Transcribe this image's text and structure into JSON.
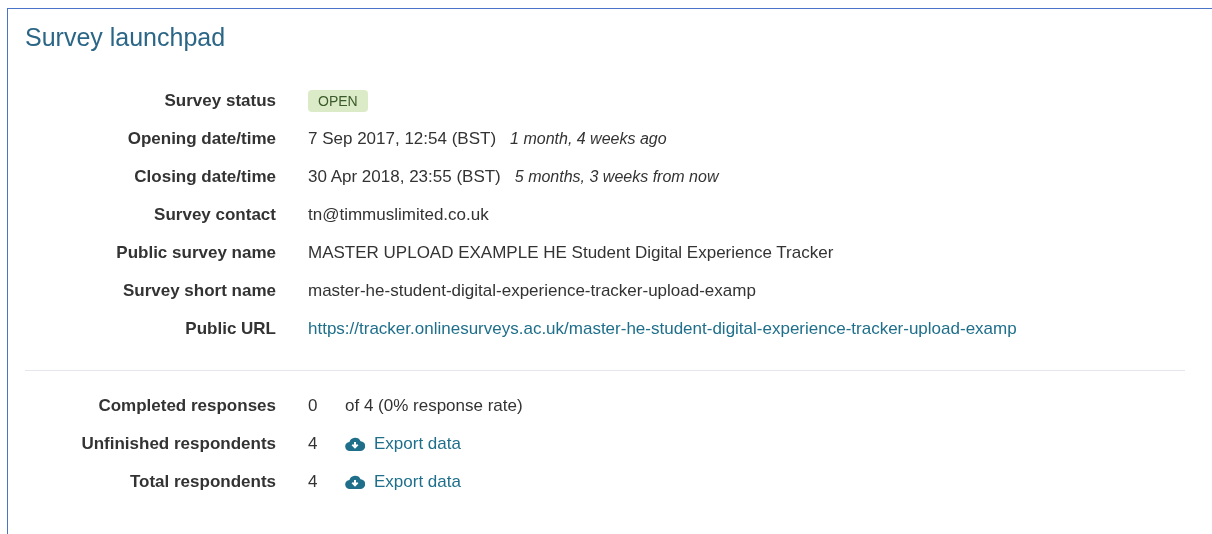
{
  "panel": {
    "title": "Survey launchpad"
  },
  "details": [
    {
      "kind": "badge",
      "label": "Survey status",
      "value": "OPEN"
    },
    {
      "kind": "date",
      "label": "Opening date/time",
      "value": "7 Sep 2017, 12:54 (BST)",
      "relative": "1 month, 4 weeks ago"
    },
    {
      "kind": "date",
      "label": "Closing date/time",
      "value": "30 Apr 2018, 23:55 (BST)",
      "relative": "5 months, 3 weeks from now"
    },
    {
      "kind": "text",
      "label": "Survey contact",
      "value": "tn@timmuslimited.co.uk"
    },
    {
      "kind": "text",
      "label": "Public survey name",
      "value": "MASTER UPLOAD EXAMPLE HE Student Digital Experience Tracker"
    },
    {
      "kind": "text",
      "label": "Survey short name",
      "value": "master-he-student-digital-experience-tracker-upload-examp"
    },
    {
      "kind": "link",
      "label": "Public URL",
      "value": "https://tracker.onlinesurveys.ac.uk/master-he-student-digital-experience-tracker-upload-examp"
    }
  ],
  "responses": [
    {
      "kind": "note",
      "label": "Completed responses",
      "count": "0",
      "note": "of 4 (0% response rate)"
    },
    {
      "kind": "export",
      "label": "Unfinished respondents",
      "count": "4",
      "link": "Export data"
    },
    {
      "kind": "export",
      "label": "Total respondents",
      "count": "4",
      "link": "Export data"
    }
  ]
}
